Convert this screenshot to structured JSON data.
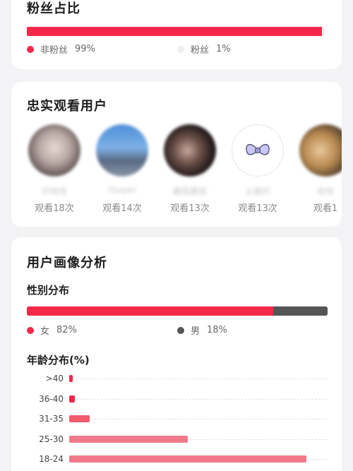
{
  "fan_ratio": {
    "title": "粉丝占比",
    "non_fans": {
      "label": "非粉丝",
      "value": "99%",
      "fraction": 0.99,
      "color": "#f5284a"
    },
    "fans": {
      "label": "粉丝",
      "value": "1%",
      "fraction": 0.01,
      "color": "#eeeeee"
    }
  },
  "loyal_viewers": {
    "title": "忠实观看用户",
    "viewers": [
      {
        "name": "印哈哈",
        "count": "观看18次",
        "avatar": "blurred-photo"
      },
      {
        "name": "Quqan",
        "count": "观看14次",
        "avatar": "blurred-photo"
      },
      {
        "name": "蘑菇蘑菇",
        "count": "观看13次",
        "avatar": "blurred-photo"
      },
      {
        "name": "么猫的",
        "count": "观看13次",
        "avatar": "bow-icon"
      },
      {
        "name": "哈哈",
        "count": "观看1",
        "avatar": "blurred-photo"
      }
    ]
  },
  "portrait": {
    "title": "用户画像分析",
    "gender": {
      "title": "性别分布",
      "female": {
        "label": "女",
        "value": "82%",
        "fraction": 0.82,
        "color": "#f5284a"
      },
      "male": {
        "label": "男",
        "value": "18%",
        "fraction": 0.18,
        "color": "#555555"
      }
    },
    "age": {
      "title": "年龄分布(%)"
    }
  },
  "chart_data": {
    "type": "bar",
    "orientation": "horizontal",
    "categories": [
      ">40",
      "36-40",
      "31-35",
      "25-30",
      "18-24"
    ],
    "values": [
      1.2,
      1.8,
      7,
      40,
      80
    ],
    "xlim": [
      0,
      82
    ],
    "grid": true,
    "colors": [
      "#f5284a",
      "#f5284a",
      "#f25a6e",
      "#f07a8a",
      "#f07a8a"
    ]
  }
}
